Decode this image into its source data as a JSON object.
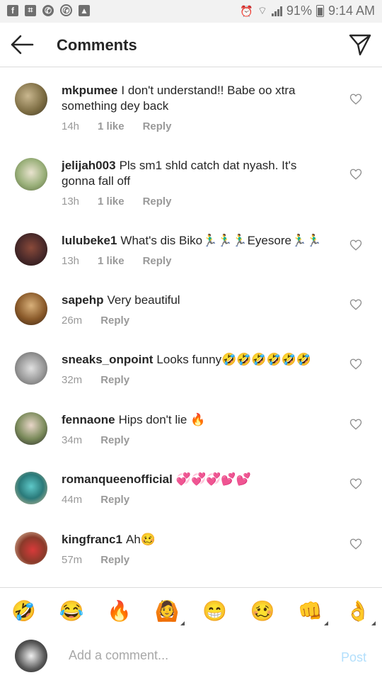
{
  "status_bar": {
    "icons_left": [
      "facebook-icon",
      "image-scan-icon",
      "whatsapp-icon",
      "whatsapp-icon",
      "gallery-icon"
    ],
    "battery": "91%",
    "time": "9:14 AM"
  },
  "header": {
    "title": "Comments"
  },
  "comments": [
    {
      "username": "mkpumee",
      "text": "I don't understand!! Babe oo xtra something dey back",
      "time": "14h",
      "likes": "1 like",
      "reply": "Reply"
    },
    {
      "username": "jelijah003",
      "text": "Pls sm1 shld catch dat nyash. It's gonna fall off",
      "time": "13h",
      "likes": "1 like",
      "reply": "Reply"
    },
    {
      "username": "lulubeke1",
      "text": "What's dis Biko🏃‍♂️🏃‍♂️🏃‍♂️Eyesore🏃‍♂️🏃‍♂️",
      "time": "13h",
      "likes": "1 like",
      "reply": "Reply"
    },
    {
      "username": "sapehp",
      "text": "Very beautiful",
      "time": "26m",
      "likes": "",
      "reply": "Reply"
    },
    {
      "username": "sneaks_onpoint",
      "text": "Looks funny🤣🤣🤣🤣🤣🤣",
      "time": "32m",
      "likes": "",
      "reply": "Reply"
    },
    {
      "username": "fennaone",
      "text": "Hips don't lie 🔥",
      "time": "34m",
      "likes": "",
      "reply": "Reply"
    },
    {
      "username": "romanqueenofficial",
      "text": "💞💞💞💕💕",
      "time": "44m",
      "likes": "",
      "reply": "Reply"
    },
    {
      "username": "kingfranc1",
      "text": "Ah🥴",
      "time": "57m",
      "likes": "",
      "reply": "Reply"
    }
  ],
  "emoji_bar": [
    "🤣",
    "😂",
    "🔥",
    "🙆",
    "😁",
    "🥴",
    "👊",
    "👌"
  ],
  "composer": {
    "placeholder": "Add a comment...",
    "post_label": "Post"
  },
  "colors": {
    "accent_disabled": "#b2dffc",
    "meta_gray": "#999999",
    "divider": "#dbdbdb"
  }
}
